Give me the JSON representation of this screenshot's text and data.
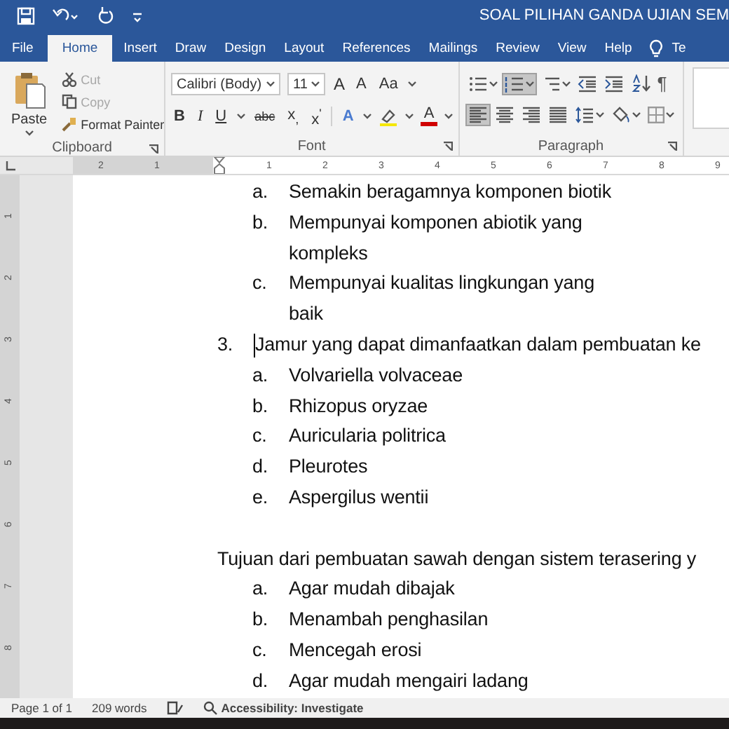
{
  "title_bar": {
    "title": "SOAL PILIHAN GANDA UJIAN SEM"
  },
  "tabs": [
    {
      "label": "File",
      "selected": false
    },
    {
      "label": "Home",
      "selected": true
    },
    {
      "label": "Insert",
      "selected": false
    },
    {
      "label": "Draw",
      "selected": false
    },
    {
      "label": "Design",
      "selected": false
    },
    {
      "label": "Layout",
      "selected": false
    },
    {
      "label": "References",
      "selected": false
    },
    {
      "label": "Mailings",
      "selected": false
    },
    {
      "label": "Review",
      "selected": false
    },
    {
      "label": "View",
      "selected": false
    },
    {
      "label": "Help",
      "selected": false
    }
  ],
  "tell_me": "Te",
  "clipboard": {
    "paste": "Paste",
    "items": [
      {
        "kind": "cut",
        "label": "Cut",
        "disabled": true
      },
      {
        "kind": "copy",
        "label": "Copy",
        "disabled": true
      },
      {
        "kind": "painter",
        "label": "Format Painter",
        "disabled": false
      }
    ],
    "group_label": "Clipboard"
  },
  "font": {
    "font_name": "Calibri (Body)",
    "font_size": "11",
    "grow": "A",
    "shrink": "A",
    "change_case": "Aa",
    "buttons": [
      {
        "kind": "bold",
        "label": "B"
      },
      {
        "kind": "italic",
        "label": "I"
      },
      {
        "kind": "underline",
        "label": "U"
      },
      {
        "kind": "strike",
        "label": "abc"
      },
      {
        "kind": "sub",
        "label": "x$_{,}$"
      },
      {
        "kind": "sup",
        "label": "x$^{'}$"
      }
    ],
    "effects": "A",
    "font_color": "A",
    "group_label": "Font"
  },
  "paragraph": {
    "row_1": [
      {
        "kind": "bullets",
        "selected": false
      },
      {
        "kind": "numbering",
        "selected": true
      },
      {
        "kind": "multilevel",
        "selected": false
      },
      {
        "kind": "outdent",
        "selected": false
      },
      {
        "kind": "indent",
        "selected": false
      },
      {
        "kind": "sort",
        "selected": false
      },
      {
        "kind": "pilcrow",
        "label": "¶",
        "selected": false
      }
    ],
    "row_2": [
      {
        "kind": "align-left",
        "selected": true
      },
      {
        "kind": "align-center",
        "selected": false
      },
      {
        "kind": "align-right",
        "selected": false
      },
      {
        "kind": "justify",
        "selected": false
      },
      {
        "kind": "spacing",
        "selected": false
      },
      {
        "kind": "shading",
        "selected": false
      },
      {
        "kind": "borders",
        "selected": false
      }
    ],
    "group_label": "Paragraph"
  },
  "ruler": {
    "left_ticks": [
      "2",
      "1"
    ],
    "ticks": [
      "1",
      "2",
      "3",
      "4",
      "5",
      "6",
      "7",
      "8",
      "9"
    ]
  },
  "vertical_ruler": {
    "ticks": [
      "1",
      "2",
      "3",
      "4",
      "5",
      "6",
      "7",
      "8"
    ]
  },
  "document": {
    "blocks": [
      {
        "kind": "option",
        "marker": "a.",
        "text": "Semakin beragamnya komponen biotik"
      },
      {
        "kind": "option",
        "marker": "b.",
        "text": "Mempunyai komponen abiotik yang kompleks"
      },
      {
        "kind": "option",
        "marker": "c.",
        "text": "Mempunyai kualitas lingkungan yang baik"
      },
      {
        "kind": "question",
        "number": "3.",
        "text": "Jamur yang dapat dimanfaatkan dalam pembuatan ke"
      },
      {
        "kind": "option",
        "marker": "a.",
        "text": "Volvariella volvaceae"
      },
      {
        "kind": "option",
        "marker": "b.",
        "text": "Rhizopus oryzae"
      },
      {
        "kind": "option",
        "marker": "c.",
        "text": "Auricularia politrica"
      },
      {
        "kind": "option",
        "marker": "d.",
        "text": "Pleurotes"
      },
      {
        "kind": "option",
        "marker": "e.",
        "text": "Aspergilus wentii"
      },
      {
        "kind": "paragraph",
        "text": "Tujuan dari pembuatan sawah dengan sistem terasering y"
      },
      {
        "kind": "option",
        "marker": "a.",
        "text": "Agar mudah dibajak"
      },
      {
        "kind": "option",
        "marker": "b.",
        "text": "Menambah penghasilan"
      },
      {
        "kind": "option",
        "marker": "c.",
        "text": "Mencegah erosi"
      },
      {
        "kind": "option",
        "marker": "d.",
        "text": "Agar mudah mengairi ladang"
      }
    ]
  },
  "status_bar": {
    "page": "Page 1 of 1",
    "words": "209 words",
    "accessibility": "Accessibility: Investigate"
  }
}
